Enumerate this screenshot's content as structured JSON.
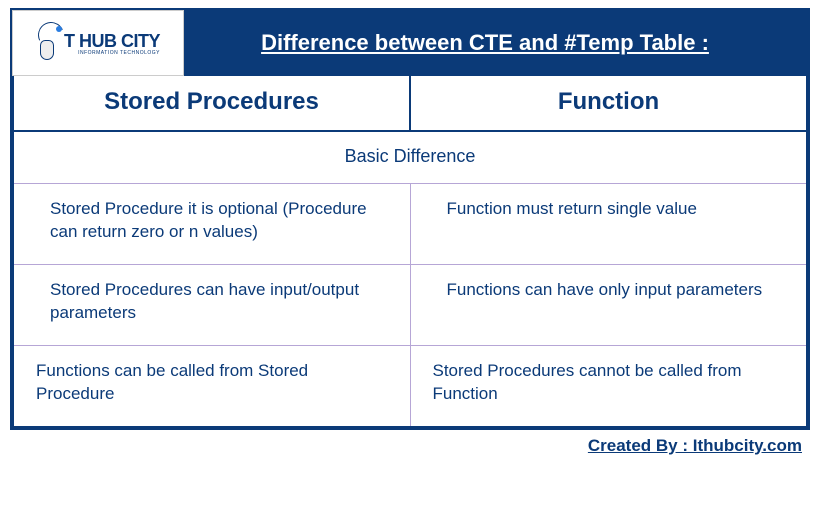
{
  "logo": {
    "brand_text": "T HUB CITY",
    "sub_text": "INFORMATION TECHNOLOGY"
  },
  "title": "Difference between CTE and #Temp Table :",
  "columns": {
    "left_header": "Stored Procedures",
    "right_header": "Function"
  },
  "section_header": "Basic Difference",
  "rows": [
    {
      "left": "Stored Procedure it is optional (Procedure can return zero or n values)",
      "right": "Function must return single value"
    },
    {
      "left": "Stored Procedures can have input/output parameters",
      "right": "Functions can have only input parameters"
    },
    {
      "left": "Functions can be called from Stored Procedure",
      "right": "Stored Procedures cannot be called from Function"
    }
  ],
  "footer": "Created By : Ithubcity.com"
}
